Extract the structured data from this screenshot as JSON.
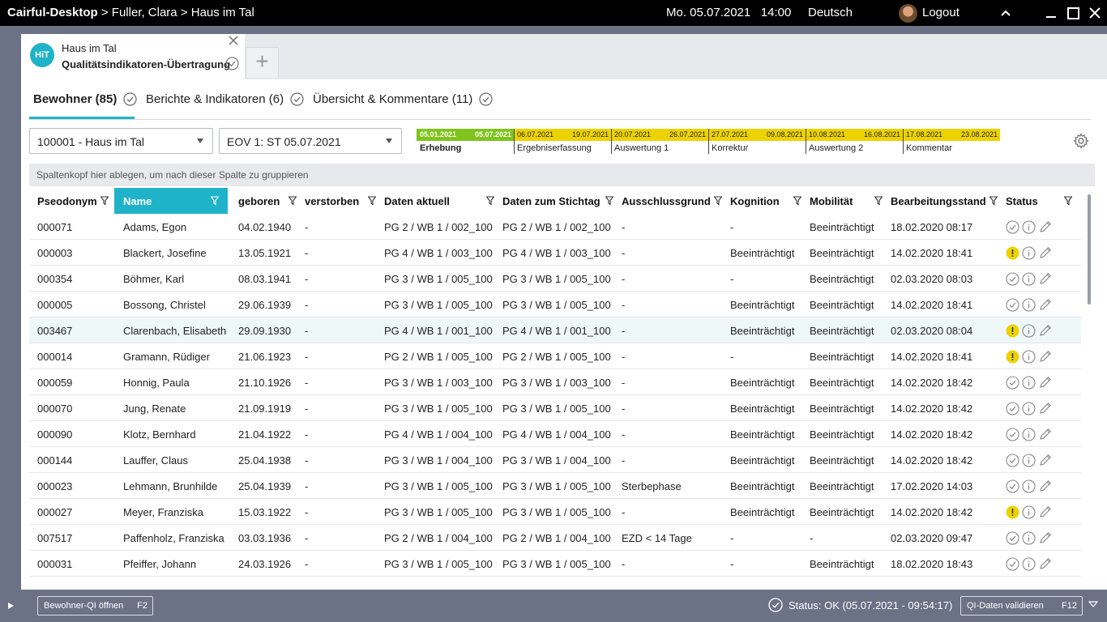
{
  "titlebar": {
    "app": "Cairful-Desktop",
    "breadcrumb_rest": " > Fuller, Clara > Haus im Tal",
    "date": "Mo. 05.07.2021",
    "time": "14:00",
    "language": "Deutsch",
    "logout": "Logout"
  },
  "doc_tab": {
    "badge": "HiT",
    "line1": "Haus im Tal",
    "line2": "Qualitätsindikatoren-Übertragung",
    "add": "+"
  },
  "subtabs": [
    {
      "label": "Bewohner (85)",
      "active": true
    },
    {
      "label": "Berichte & Indikatoren (6)",
      "active": false
    },
    {
      "label": "Übersicht & Kommentare (11)",
      "active": false
    }
  ],
  "filters": {
    "facility": "100001 - Haus im Tal",
    "period": "EOV 1: ST 05.07.2021"
  },
  "timeline": [
    {
      "start": "05.01.2021",
      "end": "05.07.2021",
      "label": "Erhebung"
    },
    {
      "start": "06.07.2021",
      "end": "19.07.2021",
      "label": "Ergebniserfassung"
    },
    {
      "start": "20.07.2021",
      "end": "26.07.2021",
      "label": "Auswertung 1"
    },
    {
      "start": "27.07.2021",
      "end": "09.08.2021",
      "label": "Korrektur"
    },
    {
      "start": "10.08.2021",
      "end": "16.08.2021",
      "label": "Auswertung 2"
    },
    {
      "start": "17.08.2021",
      "end": "23.08.2021",
      "label": "Kommentar"
    }
  ],
  "group_hint": "Spaltenkopf hier ablegen, um nach dieser Spalte zu gruppieren",
  "columns": [
    "Pseodonym",
    "Name",
    "geboren",
    "verstorben",
    "Daten aktuell",
    "Daten zum Stichtag",
    "Ausschlussgrund",
    "Kognition",
    "Mobilität",
    "Bearbeitungsstand",
    "Status"
  ],
  "rows": [
    {
      "id": "000071",
      "name": "Adams, Egon",
      "born": "04.02.1940",
      "died": "-",
      "current": "PG 2 / WB 1 / 002_100",
      "cutoff": "PG 2 / WB 1 / 002_100",
      "excl": "-",
      "cog": "-",
      "mob": "Beeinträchtigt",
      "edit": "18.02.2020 08:17",
      "warn": false
    },
    {
      "id": "000003",
      "name": "Blackert, Josefine",
      "born": "13.05.1921",
      "died": "-",
      "current": "PG 4 / WB 1 / 003_100",
      "cutoff": "PG 4 / WB 1 / 003_100",
      "excl": "-",
      "cog": "Beeinträchtigt",
      "mob": "Beeinträchtigt",
      "edit": "14.02.2020 18:41",
      "warn": true
    },
    {
      "id": "000354",
      "name": "Böhmer, Karl",
      "born": "08.03.1941",
      "died": "-",
      "current": "PG 3 / WB 1 / 005_100",
      "cutoff": "PG 3 / WB 1 / 005_100",
      "excl": "-",
      "cog": "-",
      "mob": "Beeinträchtigt",
      "edit": "02.03.2020 08:03",
      "warn": false
    },
    {
      "id": "000005",
      "name": "Bossong, Christel",
      "born": "29.06.1939",
      "died": "-",
      "current": "PG 3 / WB 1 / 005_100",
      "cutoff": "PG 3 / WB 1 / 005_100",
      "excl": "-",
      "cog": "Beeinträchtigt",
      "mob": "Beeinträchtigt",
      "edit": "14.02.2020 18:41",
      "warn": false
    },
    {
      "id": "003467",
      "name": "Clarenbach, Elisabeth",
      "born": "29.09.1930",
      "died": "-",
      "current": "PG 4 / WB 1 / 001_100",
      "cutoff": "PG 4 / WB 1 / 001_100",
      "excl": "-",
      "cog": "Beeinträchtigt",
      "mob": "Beeinträchtigt",
      "edit": "02.03.2020 08:04",
      "warn": true
    },
    {
      "id": "000014",
      "name": "Gramann, Rüdiger",
      "born": "21.06.1923",
      "died": "-",
      "current": "PG 2 / WB 1 / 005_100",
      "cutoff": "PG 2 / WB 1 / 005_100",
      "excl": "-",
      "cog": "-",
      "mob": "Beeinträchtigt",
      "edit": "14.02.2020 18:41",
      "warn": true
    },
    {
      "id": "000059",
      "name": "Honnig, Paula",
      "born": "21.10.1926",
      "died": "-",
      "current": "PG 3 / WB 1 / 003_100",
      "cutoff": "PG 3 / WB 1 / 003_100",
      "excl": "-",
      "cog": "Beeinträchtigt",
      "mob": "Beeinträchtigt",
      "edit": "14.02.2020 18:42",
      "warn": false
    },
    {
      "id": "000070",
      "name": "Jung, Renate",
      "born": "21.09.1919",
      "died": "-",
      "current": "PG 3 / WB 1 / 005_100",
      "cutoff": "PG 3 / WB 1 / 005_100",
      "excl": "-",
      "cog": "Beeinträchtigt",
      "mob": "Beeinträchtigt",
      "edit": "14.02.2020 18:42",
      "warn": false
    },
    {
      "id": "000090",
      "name": "Klotz, Bernhard",
      "born": "21.04.1922",
      "died": "-",
      "current": "PG 4 / WB 1 / 004_100",
      "cutoff": "PG 4 / WB 1 / 004_100",
      "excl": "-",
      "cog": "Beeinträchtigt",
      "mob": "Beeinträchtigt",
      "edit": "14.02.2020 18:42",
      "warn": false
    },
    {
      "id": "000144",
      "name": "Lauffer, Claus",
      "born": "25.04.1938",
      "died": "-",
      "current": "PG 3 / WB 1 / 004_100",
      "cutoff": "PG 3 / WB 1 / 004_100",
      "excl": "-",
      "cog": "Beeinträchtigt",
      "mob": "Beeinträchtigt",
      "edit": "14.02.2020 18:42",
      "warn": false
    },
    {
      "id": "000023",
      "name": "Lehmann, Brunhilde",
      "born": "25.04.1939",
      "died": "-",
      "current": "PG 3 / WB 1 / 005_100",
      "cutoff": "PG 3 / WB 1 / 005_100",
      "excl": "Sterbephase",
      "cog": "Beeinträchtigt",
      "mob": "Beeinträchtigt",
      "edit": "17.02.2020 14:03",
      "warn": false
    },
    {
      "id": "000027",
      "name": "Meyer, Franziska",
      "born": "15.03.1922",
      "died": "-",
      "current": "PG 3 / WB 1 / 005_100",
      "cutoff": "PG 3 / WB 1 / 005_100",
      "excl": "-",
      "cog": "Beeinträchtigt",
      "mob": "Beeinträchtigt",
      "edit": "14.02.2020 18:42",
      "warn": true
    },
    {
      "id": "007517",
      "name": "Paffenholz, Franziska",
      "born": "03.03.1936",
      "died": "-",
      "current": "PG 2 / WB 1 / 004_100",
      "cutoff": "PG 2 / WB 1 / 004_100",
      "excl": "EZD < 14 Tage",
      "cog": "-",
      "mob": "-",
      "edit": "02.03.2020 09:47",
      "warn": false
    },
    {
      "id": "000031",
      "name": "Pfeiffer, Johann",
      "born": "24.03.1926",
      "died": "-",
      "current": "PG 3 / WB 1 / 005_100",
      "cutoff": "PG 3 / WB 1 / 005_100",
      "excl": "-",
      "cog": "-",
      "mob": "Beeinträchtigt",
      "edit": "18.02.2020 18:43",
      "warn": false
    }
  ],
  "footer": {
    "open_btn": "Bewohner-QI öffnen",
    "open_key": "F2",
    "status": "Status: OK (05.07.2021 - 09:54:17)",
    "validate_btn": "QI-Daten validieren",
    "validate_key": "F12"
  },
  "colors": {
    "accent": "#1fb3c9",
    "warning": "#ecd200",
    "phase_active": "#7ec41c"
  },
  "icons": [
    "check-circle-icon",
    "info-icon",
    "pencil-icon",
    "warning-icon",
    "filter-icon",
    "gear-icon",
    "close-icon",
    "plus-icon"
  ]
}
